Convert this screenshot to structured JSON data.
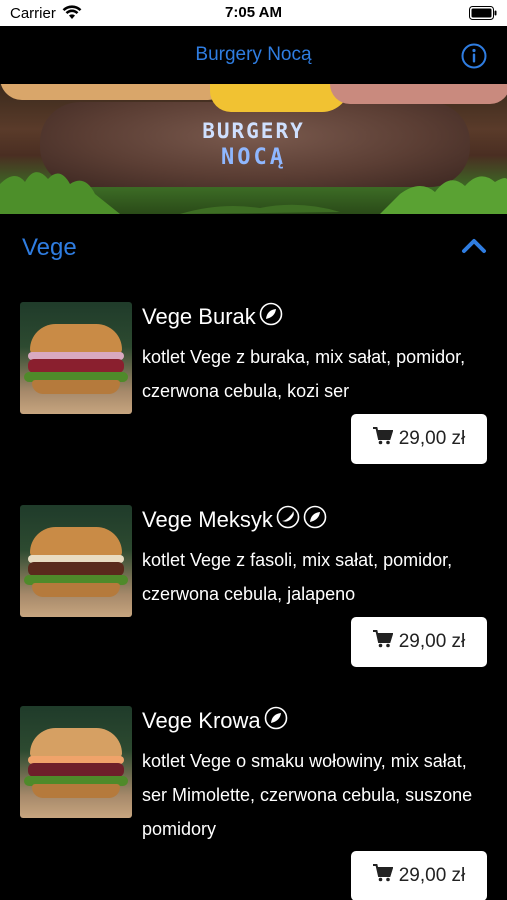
{
  "status": {
    "carrier": "Carrier",
    "time": "7:05 AM"
  },
  "nav": {
    "title": "Burgery Nocą",
    "info_icon": "info-circle-icon"
  },
  "hero": {
    "logo_line1": "BURGERY",
    "logo_line2": "NOCĄ"
  },
  "section": {
    "name": "Vege",
    "toggle_icon": "chevron-up-icon"
  },
  "colors": {
    "accent": "#2f7de1",
    "background": "#000000",
    "price_bg": "#ffffff"
  },
  "items": [
    {
      "name": "Vege Burak",
      "icons": [
        "leaf-icon"
      ],
      "description": "kotlet Vege z buraka, mix sałat, pomidor, czerwona cebula, kozi ser",
      "price": "29,00 zł"
    },
    {
      "name": "Vege Meksyk",
      "icons": [
        "chili-icon",
        "leaf-icon"
      ],
      "description": "kotlet Vege z fasoli, mix sałat, pomidor, czerwona cebula, jalapeno",
      "price": "29,00 zł"
    },
    {
      "name": "Vege Krowa",
      "icons": [
        "leaf-icon"
      ],
      "description": "kotlet Vege o smaku wołowiny, mix sałat, ser Mimolette, czerwona cebula, suszone pomidory",
      "price": "29,00 zł"
    }
  ]
}
